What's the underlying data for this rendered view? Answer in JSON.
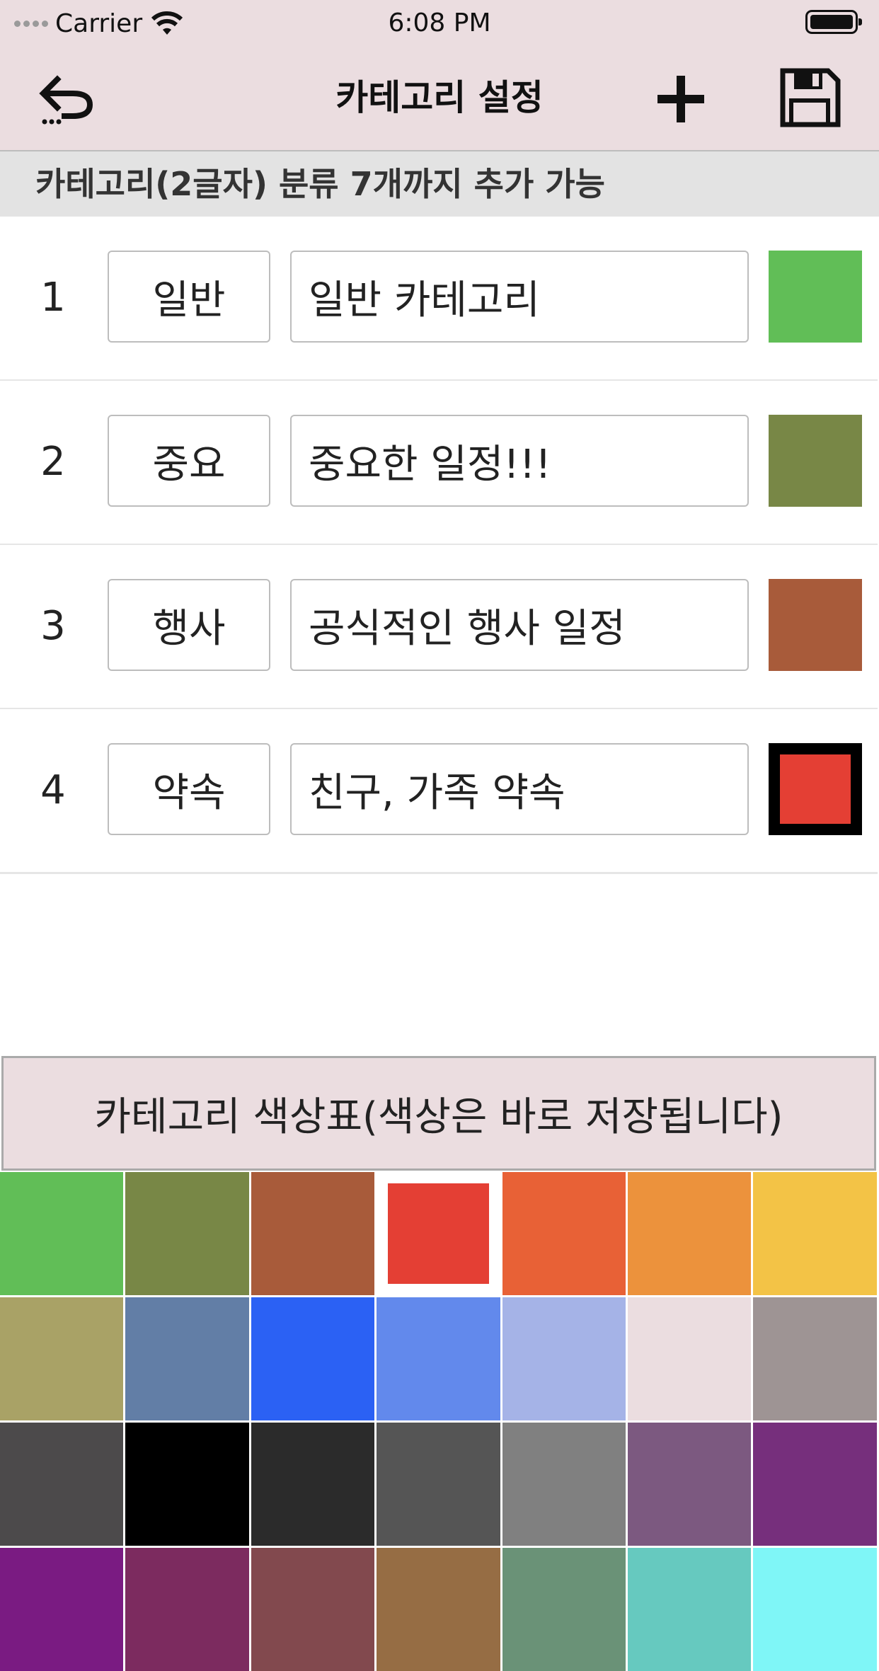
{
  "status_bar": {
    "carrier": "Carrier",
    "time": "6:08 PM"
  },
  "nav": {
    "title": "카테고리 설정",
    "back_icon": "undo-icon",
    "add_icon": "plus-icon",
    "save_icon": "save-icon"
  },
  "info": {
    "text": "카테고리(2글자) 분류 7개까지 추가 가능"
  },
  "categories": [
    {
      "num": "1",
      "name": "일반",
      "desc": "일반 카테고리",
      "color": "#61be57",
      "selected": false
    },
    {
      "num": "2",
      "name": "중요",
      "desc": "중요한 일정!!!",
      "color": "#788746",
      "selected": false
    },
    {
      "num": "3",
      "name": "행사",
      "desc": "공식적인 행사 일정",
      "color": "#a85b3a",
      "selected": false
    },
    {
      "num": "4",
      "name": "약속",
      "desc": "친구, 가족 약속",
      "color": "#e43f34",
      "selected": true
    }
  ],
  "palette": {
    "title": "카테고리 색상표(색상은 바로 저장됩니다)",
    "selected_color": "#e43f34",
    "colors": [
      "#61be57",
      "#788746",
      "#a85b3a",
      "#e43f34",
      "#e86136",
      "#ec923c",
      "#f3c346",
      "#a9a266",
      "#627ea6",
      "#2b61f4",
      "#6289ec",
      "#a5b3e7",
      "#ebdde0",
      "#9e9494",
      "#4c4a4b",
      "#000000",
      "#2b2b2b",
      "#555555",
      "#808080",
      "#7c5980",
      "#762f7c",
      "#7a1b82",
      "#7c2b5f",
      "#82494e",
      "#966d44",
      "#6a9277",
      "#66c9bf",
      "#7ff6f7"
    ]
  }
}
